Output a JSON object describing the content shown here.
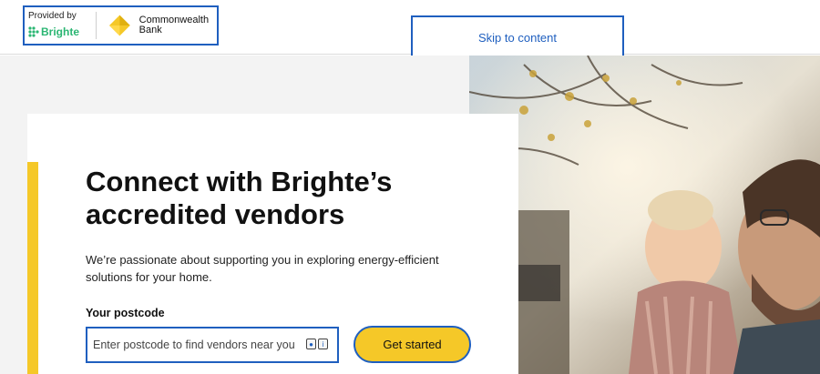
{
  "header": {
    "provided_by": "Provided by",
    "brighte_name": "Brighte",
    "bank_name_line1": "Commonwealth",
    "bank_name_line2": "Bank",
    "skip_link": "Skip to content"
  },
  "hero": {
    "title": "Connect with Brighte’s accredited vendors",
    "description": "We’re passionate about supporting you in exploring energy-efficient solutions for your home.",
    "postcode_label": "Your postcode",
    "postcode_placeholder": "Enter postcode to find vendors near you",
    "postcode_value": "",
    "cta_label": "Get started",
    "photo": "father-and-toddler-outdoors-photo"
  },
  "colors": {
    "accent_yellow": "#f5c828",
    "focus_blue": "#1f5fbf",
    "brighte_green": "#2bb673",
    "background_grey": "#f3f3f3"
  }
}
